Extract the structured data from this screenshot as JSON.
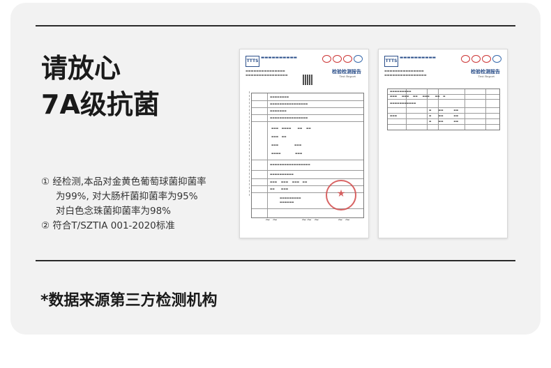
{
  "headline": {
    "line1": "请放心",
    "line2": "7A级抗菌"
  },
  "points": [
    "① 经检测,本品对金黄色葡萄球菌抑菌率",
    "为99%, 对大肠杆菌抑菌率为95%",
    "对白色念珠菌抑菌率为98%",
    "② 符合T/SZTIA 001-2020标准"
  ],
  "footnote": "*数据来源第三方检测机构",
  "report": {
    "logo_text": "TTTS",
    "title": "检验检测报告",
    "title_en": "Test Report",
    "brand_color": "#2b4f8a",
    "seal_color": "#d24a4a"
  }
}
